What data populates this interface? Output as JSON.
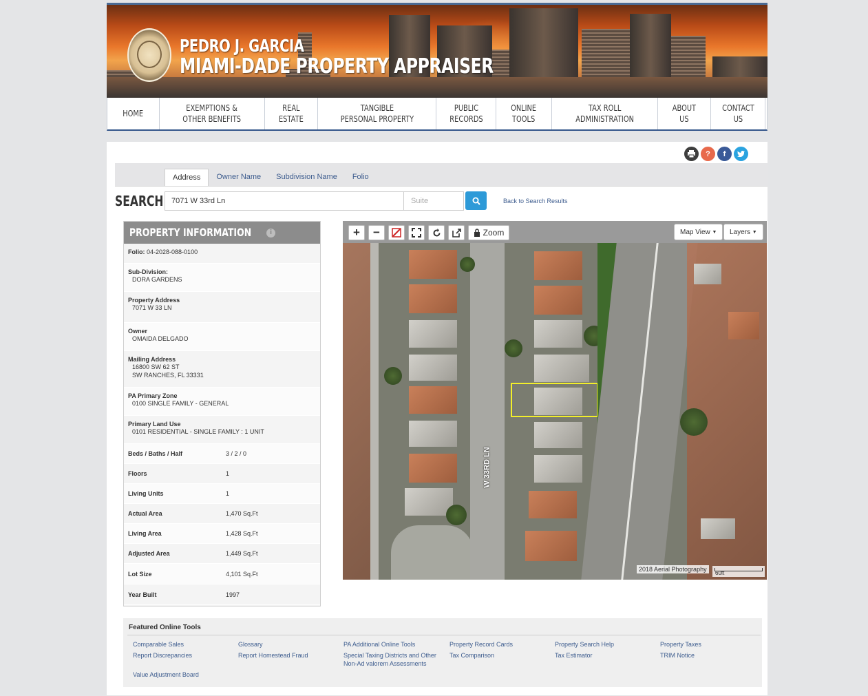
{
  "header": {
    "name_line": "PEDRO J. GARCIA",
    "title_line": "MIAMI-DADE PROPERTY APPRAISER"
  },
  "nav": [
    {
      "label": "HOME"
    },
    {
      "label": "EXEMPTIONS &\nOTHER BENEFITS"
    },
    {
      "label": "REAL\nESTATE"
    },
    {
      "label": "TANGIBLE\nPERSONAL PROPERTY"
    },
    {
      "label": "PUBLIC\nRECORDS"
    },
    {
      "label": "ONLINE\nTOOLS"
    },
    {
      "label": "TAX ROLL\nADMINISTRATION"
    },
    {
      "label": "ABOUT\nUS"
    },
    {
      "label": "CONTACT\nUS"
    }
  ],
  "social": {
    "print_icon": "printer-icon",
    "help_icon": "?",
    "facebook_icon": "f",
    "twitter_icon": "twitter-icon"
  },
  "search": {
    "tabs": [
      "Address",
      "Owner Name",
      "Subdivision Name",
      "Folio"
    ],
    "active_tab": "Address",
    "label": "SEARCH:",
    "value": "7071 W 33rd Ln",
    "suite_placeholder": "Suite",
    "back_link": "Back to Search Results"
  },
  "property": {
    "title": "PROPERTY INFORMATION",
    "folio_label": "Folio:",
    "folio": "04-2028-088-0100",
    "subdivision_label": "Sub-Division:",
    "subdivision": "DORA GARDENS",
    "address_label": "Property Address",
    "address": "7071 W 33 LN",
    "owner_label": "Owner",
    "owner": "OMAIDA DELGADO",
    "mailing_label": "Mailing Address",
    "mailing_line1": "16800 SW 62 ST",
    "mailing_line2": "SW RANCHES, FL 33331",
    "zone_label": "PA Primary Zone",
    "zone": "0100 SINGLE FAMILY - GENERAL",
    "landuse_label": "Primary Land Use",
    "landuse": "0101 RESIDENTIAL - SINGLE FAMILY : 1 UNIT",
    "stats": [
      {
        "k": "Beds / Baths / Half",
        "v": "3 / 2 / 0"
      },
      {
        "k": "Floors",
        "v": "1"
      },
      {
        "k": "Living Units",
        "v": "1"
      },
      {
        "k": "Actual Area",
        "v": "1,470 Sq.Ft"
      },
      {
        "k": "Living Area",
        "v": "1,428 Sq.Ft"
      },
      {
        "k": "Adjusted Area",
        "v": "1,449 Sq.Ft"
      },
      {
        "k": "Lot Size",
        "v": "4,101 Sq.Ft"
      },
      {
        "k": "Year Built",
        "v": "1997"
      }
    ]
  },
  "map": {
    "zoom_label": "Zoom",
    "map_view": "Map View",
    "layers": "Layers",
    "street_label": "W 33RD LN",
    "photo_label": "2018 Aerial Photography",
    "scale_label": "60ft"
  },
  "featured": {
    "title": "Featured Online Tools",
    "columns": [
      [
        "Comparable Sales",
        "Report Discrepancies",
        "Value Adjustment Board"
      ],
      [
        "Glossary",
        "Report Homestead Fraud"
      ],
      [
        "PA Additional Online Tools",
        "Special Taxing Districts and Other Non-Ad valorem Assessments"
      ],
      [
        "Property Record Cards",
        "Tax Comparison"
      ],
      [
        "Property Search Help",
        "Tax Estimator"
      ],
      [
        "Property Taxes",
        "TRIM Notice"
      ]
    ]
  }
}
